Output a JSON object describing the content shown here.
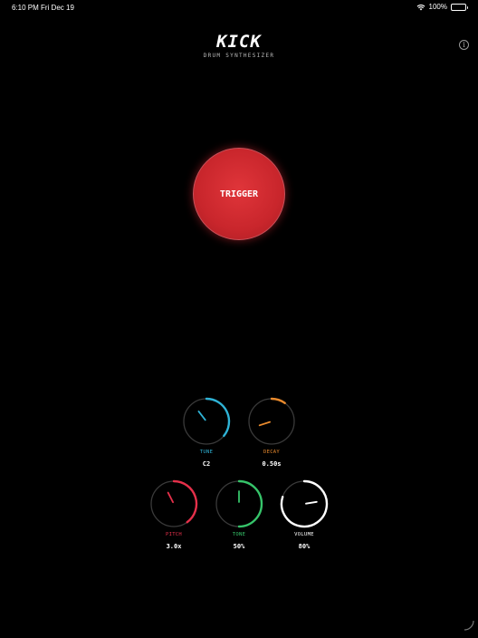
{
  "status_bar": {
    "time": "6:10 PM",
    "date": "Fri Dec 19",
    "battery": "100%"
  },
  "header": {
    "title": "KICK",
    "subtitle": "DRUM SYNTHESIZER",
    "info_icon": "info-icon"
  },
  "trigger": {
    "label": "TRIGGER",
    "color": "#d62f35"
  },
  "knobs": [
    {
      "id": "tune",
      "label": "TUNE",
      "value": "C2",
      "level": 0.36,
      "color": "#2fb3d6"
    },
    {
      "id": "decay",
      "label": "DECAY",
      "value": "0.50s",
      "level": 0.1,
      "color": "#e98a2d"
    },
    {
      "id": "pitch",
      "label": "PITCH",
      "value": "3.0x",
      "level": 0.4,
      "color": "#e5304a"
    },
    {
      "id": "tone",
      "label": "TONE",
      "value": "50%",
      "level": 0.5,
      "color": "#36c46a"
    },
    {
      "id": "volume",
      "label": "VOLUME",
      "value": "80%",
      "level": 0.8,
      "color": "#ffffff"
    }
  ]
}
